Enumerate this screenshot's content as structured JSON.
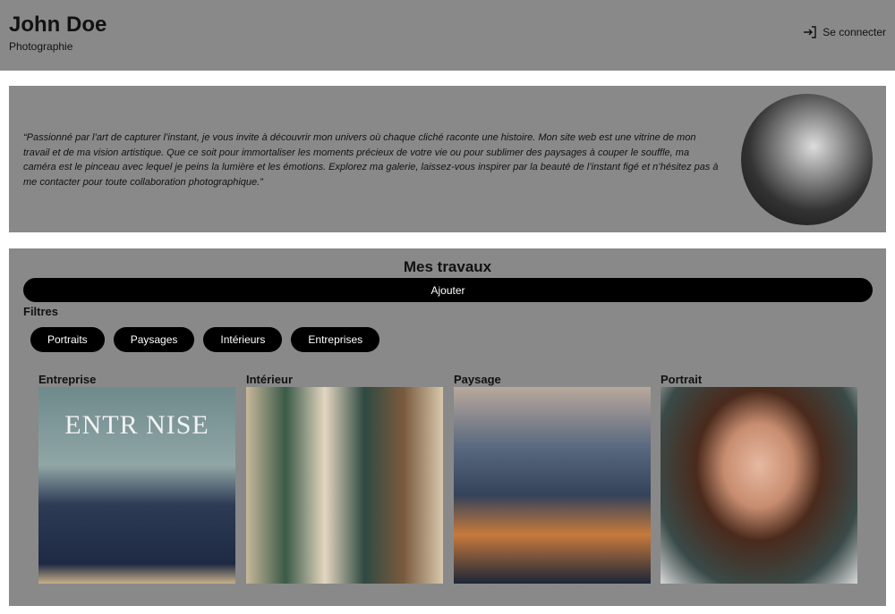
{
  "header": {
    "name": "John Doe",
    "subtitle": "Photographie",
    "login_label": "Se connecter",
    "login_icon": "sign-in-icon"
  },
  "about": {
    "quote": "“Passionné par l’art de capturer l’instant, je vous invite à découvrir mon univers où chaque cliché raconte une histoire. Mon site web est une vitrine de mon travail et de ma vision artistique. Que ce soit pour immortaliser les moments précieux de votre vie ou pour sublimer des paysages à couper le souffle, ma caméra est le pinceau avec lequel je peins la lumière et les émotions. Explorez ma galerie, laissez-vous inspirer par la beauté de l’instant figé et n’hésitez pas à me contacter pour toute collaboration photographique.”"
  },
  "gallery": {
    "title": "Mes travaux",
    "add_label": "Ajouter",
    "filters_title": "Filtres",
    "filters": [
      "Portraits",
      "Paysages",
      "Intérieurs",
      "Entreprises"
    ],
    "works": [
      {
        "label": "Entreprise",
        "image_text": "ENTR NISE"
      },
      {
        "label": "Intérieur"
      },
      {
        "label": "Paysage"
      },
      {
        "label": "Portrait"
      }
    ]
  }
}
